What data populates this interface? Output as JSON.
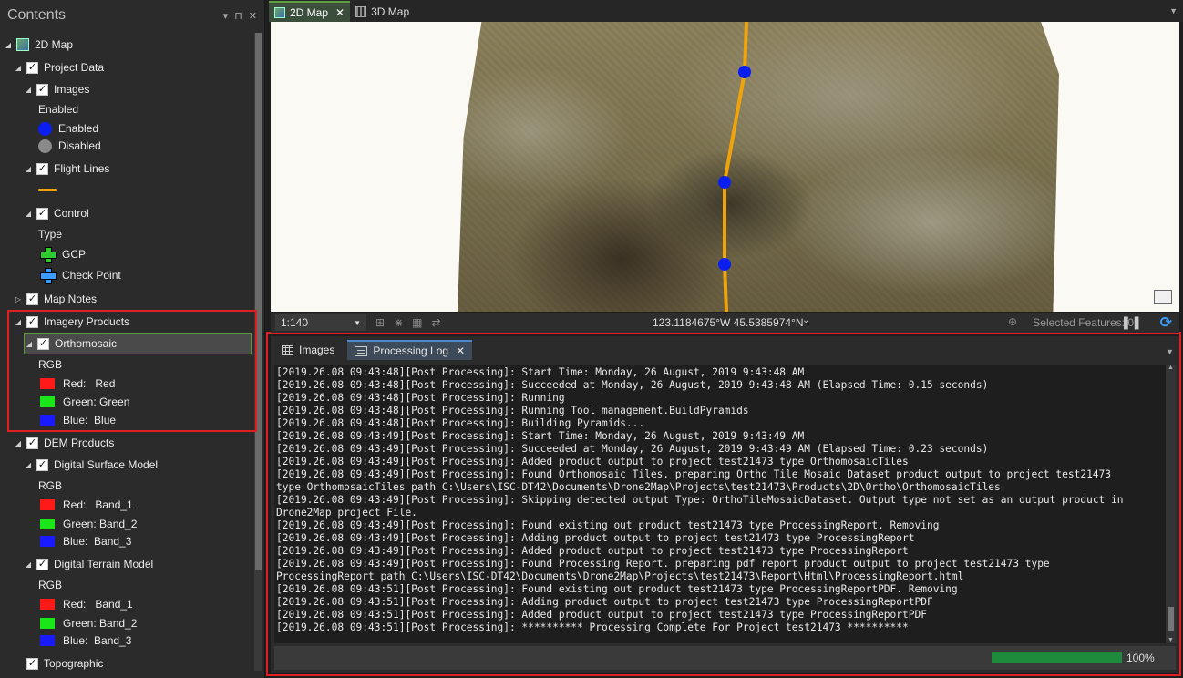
{
  "contents": {
    "title": "Contents",
    "controls": [
      "▾",
      "⊓",
      "✕"
    ],
    "tree": {
      "map": "2D Map",
      "project_data": "Project Data",
      "images": "Images",
      "images_field": "Enabled",
      "images_enabled": "Enabled",
      "images_disabled": "Disabled",
      "flight_lines": "Flight Lines",
      "control": "Control",
      "control_field": "Type",
      "gcp": "GCP",
      "check_point": "Check Point",
      "map_notes": "Map Notes",
      "imagery_products": "Imagery Products",
      "orthomosaic": "Orthomosaic",
      "ortho_rgb": "RGB",
      "ortho_red": "Red:   Red",
      "ortho_green": "Green: Green",
      "ortho_blue": "Blue:  Blue",
      "dem_products": "DEM Products",
      "dsm": "Digital Surface Model",
      "dsm_rgb": "RGB",
      "dsm_red": "Red:   Band_1",
      "dsm_green": "Green: Band_2",
      "dsm_blue": "Blue:  Band_3",
      "dtm": "Digital Terrain Model",
      "dtm_rgb": "RGB",
      "dtm_red": "Red:   Band_1",
      "dtm_green": "Green: Band_2",
      "dtm_blue": "Blue:  Band_3",
      "topographic": "Topographic"
    }
  },
  "map_tabs": [
    {
      "label": "2D Map",
      "close": "✕",
      "active": true
    },
    {
      "label": "3D Map",
      "active": false
    }
  ],
  "map_status": {
    "scale": "1:140",
    "coordinates": "123.1184675°W 45.5385974°N",
    "selected_features": "Selected Features: 0"
  },
  "bottom_tabs": [
    {
      "label": "Images",
      "active": false
    },
    {
      "label": "Processing Log",
      "close": "✕",
      "active": true
    }
  ],
  "log_lines": [
    "[2019.26.08 09:43:48][Post Processing]: Start Time: Monday, 26 August, 2019 9:43:48 AM",
    "[2019.26.08 09:43:48][Post Processing]: Succeeded at Monday, 26 August, 2019 9:43:48 AM (Elapsed Time: 0.15 seconds)",
    "[2019.26.08 09:43:48][Post Processing]: Running",
    "[2019.26.08 09:43:48][Post Processing]: Running Tool management.BuildPyramids",
    "[2019.26.08 09:43:48][Post Processing]: Building Pyramids...",
    "[2019.26.08 09:43:49][Post Processing]: Start Time: Monday, 26 August, 2019 9:43:49 AM",
    "[2019.26.08 09:43:49][Post Processing]: Succeeded at Monday, 26 August, 2019 9:43:49 AM (Elapsed Time: 0.23 seconds)",
    "[2019.26.08 09:43:49][Post Processing]: Added product output to project test21473 type OrthomosaicTiles",
    "[2019.26.08 09:43:49][Post Processing]: Found Orthomosaic Tiles. preparing Ortho Tile Mosaic Dataset product output to project test21473",
    "type OrthomosaicTiles path C:\\Users\\ISC-DT42\\Documents\\Drone2Map\\Projects\\test21473\\Products\\2D\\Ortho\\OrthomosaicTiles",
    "[2019.26.08 09:43:49][Post Processing]: Skipping detected output Type: OrthoTileMosaicDataset. Output type not set as an output product in",
    "Drone2Map project File.",
    "[2019.26.08 09:43:49][Post Processing]: Found existing out product test21473 type ProcessingReport. Removing",
    "[2019.26.08 09:43:49][Post Processing]: Adding product output to project test21473 type ProcessingReport",
    "[2019.26.08 09:43:49][Post Processing]: Added product output to project test21473 type ProcessingReport",
    "[2019.26.08 09:43:49][Post Processing]: Found Processing Report. preparing pdf report product output to project test21473 type",
    "ProcessingReport path C:\\Users\\ISC-DT42\\Documents\\Drone2Map\\Projects\\test21473\\Report\\Html\\ProcessingReport.html",
    "[2019.26.08 09:43:51][Post Processing]: Found existing out product test21473 type ProcessingReportPDF. Removing",
    "[2019.26.08 09:43:51][Post Processing]: Adding product output to project test21473 type ProcessingReportPDF",
    "[2019.26.08 09:43:51][Post Processing]: Added product output to project test21473 type ProcessingReportPDF",
    "[2019.26.08 09:43:51][Post Processing]: ********** Processing Complete For Project test21473 **********"
  ],
  "progress": {
    "fraction": 1.0,
    "label": "100%"
  },
  "colors": {
    "accent_green": "#5da040",
    "highlight_red": "#e02020",
    "flight_line": "#f0a30a",
    "image_point": "#0a1ef0",
    "progress": "#1e8a3c"
  }
}
